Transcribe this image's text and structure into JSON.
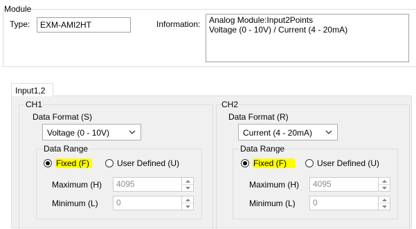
{
  "module": {
    "group_label": "Module",
    "type_label": "Type:",
    "type_value": "EXM-AMI2HT",
    "information_label": "Information:",
    "information_lines": [
      "Analog Module:Input2Points",
      "Voltage (0 - 10V) / Current (4 - 20mA)"
    ]
  },
  "tab": {
    "label": "Input1,2"
  },
  "channels": [
    {
      "label": "CH1",
      "data_format_label": "Data Format (S)",
      "data_format_value": "Voltage (0 - 10V)",
      "data_range_label": "Data Range",
      "fixed_label": "Fixed (F)",
      "user_defined_label": "User Defined (U)",
      "fixed_selected": true,
      "maximum_label": "Maximum (H)",
      "maximum_value": "4095",
      "minimum_label": "Minimum (L)",
      "minimum_value": "0"
    },
    {
      "label": "CH2",
      "data_format_label": "Data Format (R)",
      "data_format_value": "Current (4 - 20mA)",
      "data_range_label": "Data Range",
      "fixed_label": "Fixed (F)",
      "user_defined_label": "User Defined (U)",
      "fixed_selected": true,
      "maximum_label": "Maximum (H)",
      "maximum_value": "4095",
      "minimum_label": "Minimum (L)",
      "minimum_value": "0"
    }
  ],
  "colors": {
    "highlight": "#ffff00",
    "disabled_text": "#8c8c8c",
    "panel_background": "#f0f0f0"
  },
  "icons": {
    "dropdown": "chevron-down-icon",
    "spin_up": "spin-up-icon",
    "spin_down": "spin-down-icon"
  }
}
